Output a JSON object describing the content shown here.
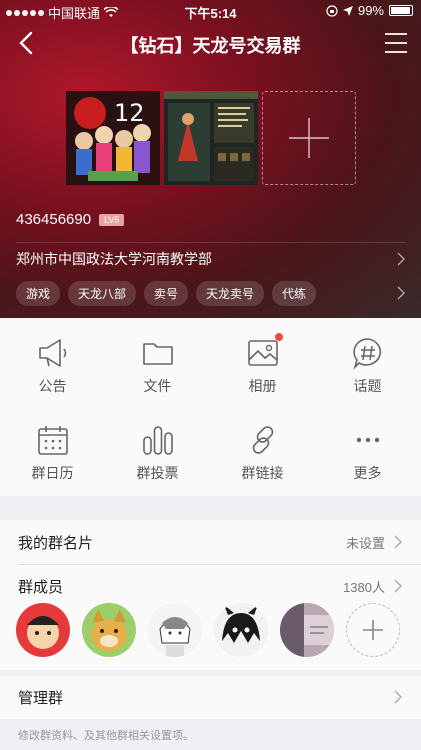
{
  "status": {
    "carrier": "中国联通",
    "time": "下午5:14",
    "battery": "99%"
  },
  "nav": {
    "title": "【钻石】天龙号交易群"
  },
  "group": {
    "id": "436456690",
    "level": "LV5",
    "location": "郑州市中国政法大学河南教学部",
    "tags": [
      "游戏",
      "天龙八部",
      "卖号",
      "天龙卖号",
      "代练"
    ]
  },
  "features": [
    {
      "label": "公告",
      "icon": "megaphone-icon"
    },
    {
      "label": "文件",
      "icon": "folder-icon"
    },
    {
      "label": "相册",
      "icon": "album-icon"
    },
    {
      "label": "话题",
      "icon": "topic-icon"
    },
    {
      "label": "群日历",
      "icon": "calendar-icon"
    },
    {
      "label": "群投票",
      "icon": "vote-icon"
    },
    {
      "label": "群链接",
      "icon": "link-icon"
    },
    {
      "label": "更多",
      "icon": "more-icon"
    }
  ],
  "card": {
    "label": "我的群名片",
    "value": "未设置"
  },
  "members": {
    "label": "群成员",
    "count": "1380人"
  },
  "admin": {
    "label": "管理群",
    "note": "修改群资料、及其他群相关设置项。"
  },
  "colors": {
    "accent_red": "#b0182a",
    "badge": "#e7a3a3",
    "notify_dot": "#ff4444"
  }
}
